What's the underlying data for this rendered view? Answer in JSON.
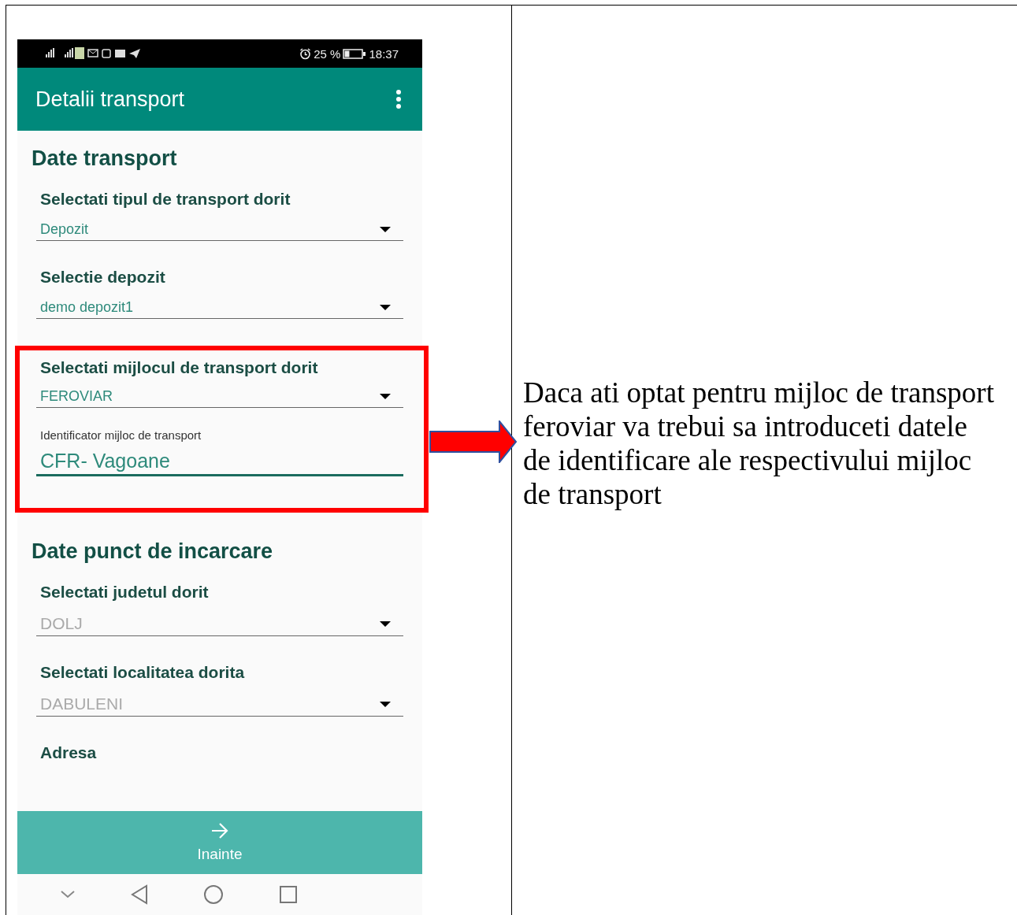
{
  "status_bar": {
    "battery": "25 %",
    "time": "18:37"
  },
  "app_bar": {
    "title": "Detalii transport"
  },
  "sections": [
    {
      "heading": "Date transport",
      "fields": [
        {
          "kind": "dropdown",
          "label": "Selectati tipul de transport dorit",
          "value": "Depozit",
          "disabled": false,
          "highlighted": false
        },
        {
          "kind": "dropdown",
          "label": "Selectie depozit",
          "value": "demo depozit1",
          "disabled": false,
          "highlighted": false
        },
        {
          "kind": "dropdown",
          "label": "Selectati mijlocul de transport dorit",
          "value": "FEROVIAR",
          "disabled": false,
          "highlighted": true
        },
        {
          "kind": "text",
          "label": "Identificator mijloc de transport",
          "value": "CFR- Vagoane",
          "disabled": false,
          "highlighted": true
        }
      ]
    },
    {
      "heading": "Date punct de incarcare",
      "fields": [
        {
          "kind": "dropdown",
          "label": "Selectati judetul dorit",
          "value": "DOLJ",
          "disabled": true,
          "highlighted": false
        },
        {
          "kind": "dropdown",
          "label": "Selectati localitatea dorita",
          "value": "DABULENI",
          "disabled": true,
          "highlighted": false
        },
        {
          "kind": "heading",
          "label": "Adresa",
          "highlighted": false
        }
      ]
    }
  ],
  "bottom_button": {
    "label": "Inainte"
  },
  "callout": {
    "text": "Daca ati optat pentru mijloc de transport feroviar va trebui sa introduceti datele de identificare ale respectivului mijloc de transport"
  }
}
